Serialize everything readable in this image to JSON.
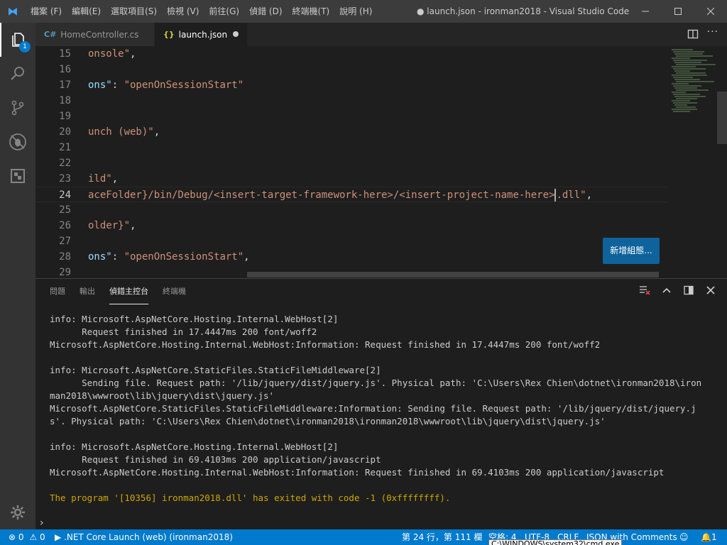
{
  "window": {
    "title": "● launch.json - ironman2018 - Visual Studio Code",
    "menu": [
      "檔案 (F)",
      "編輯(E)",
      "選取項目(S)",
      "檢視 (V)",
      "前往(G)",
      "偵錯 (D)",
      "終端機(T)",
      "說明 (H)"
    ]
  },
  "activity": {
    "badge": "1",
    "items": [
      "explorer-icon",
      "search-icon",
      "source-control-icon",
      "debug-icon",
      "extensions-icon",
      "gear-icon"
    ]
  },
  "tabs": [
    {
      "label": "HomeController.cs",
      "icon": "C#"
    },
    {
      "label": "launch.json",
      "icon": "{}"
    }
  ],
  "editor": {
    "lines": [
      {
        "n": "15",
        "parts": [
          {
            "t": "onsole\"",
            "c": "s"
          },
          {
            "t": ",",
            "c": "p"
          }
        ]
      },
      {
        "n": "16",
        "parts": []
      },
      {
        "n": "17",
        "parts": [
          {
            "t": "ons\"",
            "c": "k"
          },
          {
            "t": ": ",
            "c": "p"
          },
          {
            "t": "\"openOnSessionStart\"",
            "c": "s"
          }
        ]
      },
      {
        "n": "18",
        "parts": []
      },
      {
        "n": "19",
        "parts": []
      },
      {
        "n": "20",
        "parts": [
          {
            "t": "unch (web)\"",
            "c": "s"
          },
          {
            "t": ",",
            "c": "p"
          }
        ]
      },
      {
        "n": "21",
        "parts": []
      },
      {
        "n": "22",
        "parts": []
      },
      {
        "n": "23",
        "parts": [
          {
            "t": "ild\"",
            "c": "s"
          },
          {
            "t": ",",
            "c": "p"
          }
        ]
      },
      {
        "n": "24",
        "parts": [
          {
            "t": "aceFolder}/bin/Debug/<insert-target-framework-here>/<insert-project-name-here>",
            "c": "s"
          },
          {
            "t": "|",
            "c": "cursor"
          },
          {
            "t": ".dll\"",
            "c": "s"
          },
          {
            "t": ",",
            "c": "p"
          }
        ]
      },
      {
        "n": "25",
        "parts": []
      },
      {
        "n": "26",
        "parts": [
          {
            "t": "older}\"",
            "c": "s"
          },
          {
            "t": ",",
            "c": "p"
          }
        ]
      },
      {
        "n": "27",
        "parts": []
      },
      {
        "n": "28",
        "parts": [
          {
            "t": "ons\"",
            "c": "k"
          },
          {
            "t": ": ",
            "c": "p"
          },
          {
            "t": "\"openOnSessionStart\"",
            "c": "s"
          },
          {
            "t": ",",
            "c": "p"
          }
        ]
      },
      {
        "n": "29",
        "parts": []
      }
    ],
    "add_config_button": "新增組態..."
  },
  "panel": {
    "tabs": [
      "問題",
      "輸出",
      "偵錯主控台",
      "終端機"
    ],
    "active_tab": 2,
    "console": [
      {
        "t": "info: Microsoft.AspNetCore.Hosting.Internal.WebHost[2]"
      },
      {
        "t": "      Request finished in 17.4447ms 200 font/woff2"
      },
      {
        "t": "Microsoft.AspNetCore.Hosting.Internal.WebHost:Information: Request finished in 17.4447ms 200 font/woff2"
      },
      {
        "t": ""
      },
      {
        "t": "info: Microsoft.AspNetCore.StaticFiles.StaticFileMiddleware[2]"
      },
      {
        "t": "      Sending file. Request path: '/lib/jquery/dist/jquery.js'. Physical path: 'C:\\Users\\Rex Chien\\dotnet\\ironman2018\\iron"
      },
      {
        "t": "man2018\\wwwroot\\lib\\jquery\\dist\\jquery.js'"
      },
      {
        "t": "Microsoft.AspNetCore.StaticFiles.StaticFileMiddleware:Information: Sending file. Request path: '/lib/jquery/dist/jquery.j"
      },
      {
        "t": "s'. Physical path: 'C:\\Users\\Rex Chien\\dotnet\\ironman2018\\ironman2018\\wwwroot\\lib\\jquery\\dist\\jquery.js'"
      },
      {
        "t": ""
      },
      {
        "t": "info: Microsoft.AspNetCore.Hosting.Internal.WebHost[2]"
      },
      {
        "t": "      Request finished in 69.4103ms 200 application/javascript"
      },
      {
        "t": "Microsoft.AspNetCore.Hosting.Internal.WebHost:Information: Request finished in 69.4103ms 200 application/javascript"
      },
      {
        "t": ""
      },
      {
        "t": "The program '[10356] ironman2018.dll' has exited with code -1 (0xffffffff).",
        "warn": true
      }
    ],
    "prompt": "›"
  },
  "status": {
    "errors": "0",
    "warnings": "0",
    "launch": ".NET Core Launch (web) (ironman2018)",
    "position": "第 24 行，第 111 欄",
    "spaces": "空格: 4",
    "encoding": "UTF-8",
    "eol": "CRLF",
    "language": "JSON with Comments",
    "bell": "1"
  },
  "tooltip": "C:\\WINDOWS\\system32\\cmd.exe"
}
